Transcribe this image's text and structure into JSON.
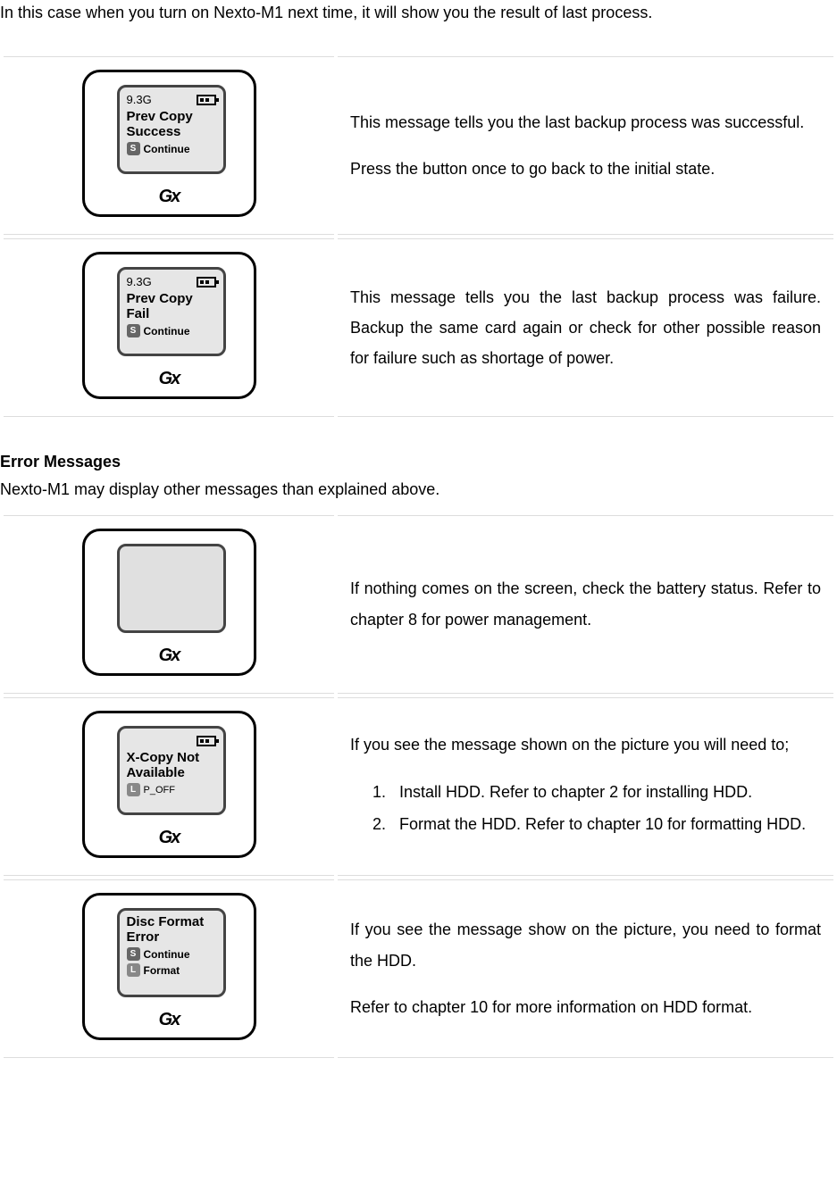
{
  "intro": "In this case when you turn on Nexto-M1 next time, it will show you the result of last process.",
  "rows1": [
    {
      "screen": {
        "cap": "9.3G",
        "line1": "Prev Copy",
        "line2": "Success",
        "btnS": "Continue"
      },
      "para1": "This message tells you the last backup process was successful.",
      "para2": "Press the button once to go back to the initial state."
    },
    {
      "screen": {
        "cap": "9.3G",
        "line1": "Prev Copy",
        "line2": "Fail",
        "btnS": "Continue"
      },
      "para1": "This message tells you the last backup process was failure. Backup the same card again or check for other possible reason for failure such as shortage of power."
    }
  ],
  "subhead": "Error Messages",
  "subtxt": "Nexto-M1 may display other messages than explained above.",
  "rows2": [
    {
      "screen": {
        "blank": true
      },
      "para1": "If nothing comes on the screen, check the battery status. Refer to chapter 8 for power management."
    },
    {
      "screen": {
        "noCap": true,
        "line1": "X-Copy Not",
        "line2": "Available",
        "btnL": "P_OFF"
      },
      "lead": "If you see the message shown on the picture you will need to;",
      "list": [
        "Install HDD. Refer to chapter 2 for installing HDD.",
        "Format the HDD. Refer to chapter 10 for formatting HDD."
      ]
    },
    {
      "screen": {
        "noBatt": true,
        "line0": "Disc Format",
        "line0b": "Error",
        "btnS": "Continue",
        "btnL": "Format"
      },
      "para1": "If you see the message show on the picture, you need to format the HDD.",
      "para2": "Refer to chapter 10 for more information on HDD format."
    }
  ],
  "logo": "Gx"
}
